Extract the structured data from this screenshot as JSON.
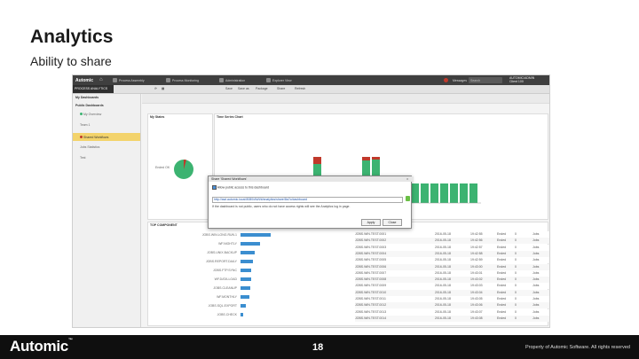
{
  "slide": {
    "title": "Analytics",
    "subtitle": "Ability to share"
  },
  "app": {
    "logo": "Automic",
    "nav": [
      "Process Assembly",
      "Process Monitoring",
      "Administration",
      "Explorer View"
    ],
    "messages_label": "Messages",
    "search_placeholder": "Search",
    "user_line1": "AUTOMIC/ADMIN",
    "user_line2": "Client 100",
    "toolbar_tab": "PROCESS ANALYTICS",
    "toolbar_buttons": [
      "Save",
      "Save as",
      "Package",
      "Share",
      "Refresh"
    ]
  },
  "sidebar": {
    "sections": [
      "My Dashboards",
      "Public Dashboards"
    ],
    "items": [
      "My Overview",
      "Team 1",
      "Activity Overview",
      "Shared Workflows",
      "Jobs Statistics",
      "Test"
    ],
    "selected_index": 3
  },
  "panels": {
    "my_states_title": "My States",
    "timeline_title": "Time Series Chart",
    "bottom_title": "TOP COMPONENT",
    "pie_label": "Ended OK"
  },
  "dialog": {
    "title": "Share 'Shared Workflows'",
    "close": "x",
    "option": "Allow public access to this dashboard",
    "link": "http://awi.automic.local:8080/AWI/#/analytics/share/8a7c/dashboard",
    "note": "If the dashboard is not public, users who do not have access rights will see the Analytics log in page.",
    "apply": "Apply",
    "close_btn": "Close"
  },
  "bottom_bars": [
    "JOBS.WIN.LONG.RUN.1",
    "WF.NIGHTLY",
    "JOBS.UNIX.BACKUP",
    "JOBS.REPORT.DAILY",
    "JOBS.FTP.SYNC",
    "WF.DATA.LOAD",
    "JOBS.CLEANUP",
    "WF.MONTHLY",
    "JOBS.SQL.EXPORT",
    "JOBS.CHECK"
  ],
  "table_rows": [
    [
      "JOBS.WIN.TEST.0001",
      "2016-05-18",
      "19:42:55",
      "Ended",
      "0",
      "Jobs"
    ],
    [
      "JOBS.WIN.TEST.0002",
      "2016-05-18",
      "19:42:56",
      "Ended",
      "0",
      "Jobs"
    ],
    [
      "JOBS.WIN.TEST.0003",
      "2016-05-18",
      "19:42:57",
      "Ended",
      "0",
      "Jobs"
    ],
    [
      "JOBS.WIN.TEST.0004",
      "2016-05-18",
      "19:42:58",
      "Ended",
      "0",
      "Jobs"
    ],
    [
      "JOBS.WIN.TEST.0005",
      "2016-05-18",
      "19:42:59",
      "Ended",
      "0",
      "Jobs"
    ],
    [
      "JOBS.WIN.TEST.0006",
      "2016-05-18",
      "19:43:00",
      "Ended",
      "0",
      "Jobs"
    ],
    [
      "JOBS.WIN.TEST.0007",
      "2016-05-18",
      "19:43:01",
      "Ended",
      "0",
      "Jobs"
    ],
    [
      "JOBS.WIN.TEST.0008",
      "2016-05-18",
      "19:43:02",
      "Ended",
      "0",
      "Jobs"
    ],
    [
      "JOBS.WIN.TEST.0009",
      "2016-05-18",
      "19:43:03",
      "Ended",
      "0",
      "Jobs"
    ],
    [
      "JOBS.WIN.TEST.0010",
      "2016-05-18",
      "19:43:04",
      "Ended",
      "0",
      "Jobs"
    ],
    [
      "JOBS.WIN.TEST.0011",
      "2016-05-18",
      "19:43:05",
      "Ended",
      "0",
      "Jobs"
    ],
    [
      "JOBS.WIN.TEST.0012",
      "2016-05-18",
      "19:43:06",
      "Ended",
      "0",
      "Jobs"
    ],
    [
      "JOBS.WIN.TEST.0013",
      "2016-05-18",
      "19:43:07",
      "Ended",
      "0",
      "Jobs"
    ],
    [
      "JOBS.WIN.TEST.0014",
      "2016-05-18",
      "19:43:08",
      "Ended",
      "0",
      "Jobs"
    ]
  ],
  "colors": {
    "ok_green": "#3cb371",
    "err_red": "#c0392b",
    "bar_blue": "#3b8ed0",
    "selection": "#f3d36b"
  },
  "footer": {
    "brand": "Automic",
    "page_number": "18",
    "copyright": "Property of Automic Software. All rights reserved"
  }
}
